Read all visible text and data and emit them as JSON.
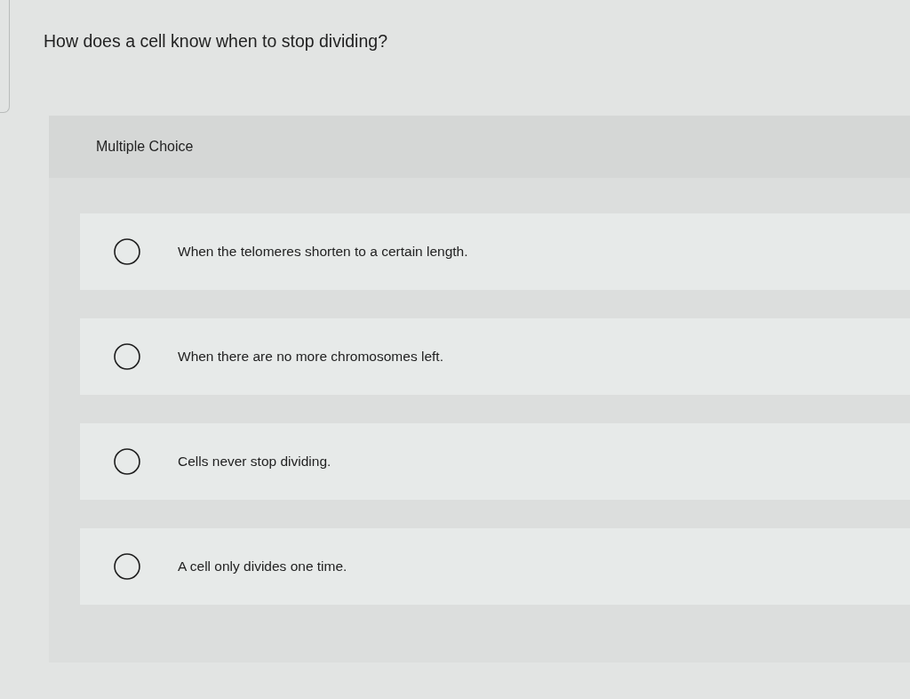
{
  "question": "How does a cell know when to stop dividing?",
  "panel": {
    "label": "Multiple Choice"
  },
  "options": [
    {
      "text": "When the telomeres shorten to a certain length.",
      "selected": false
    },
    {
      "text": "When there are no more chromosomes left.",
      "selected": false
    },
    {
      "text": "Cells never stop dividing.",
      "selected": false
    },
    {
      "text": "A cell only divides one time.",
      "selected": false
    }
  ]
}
